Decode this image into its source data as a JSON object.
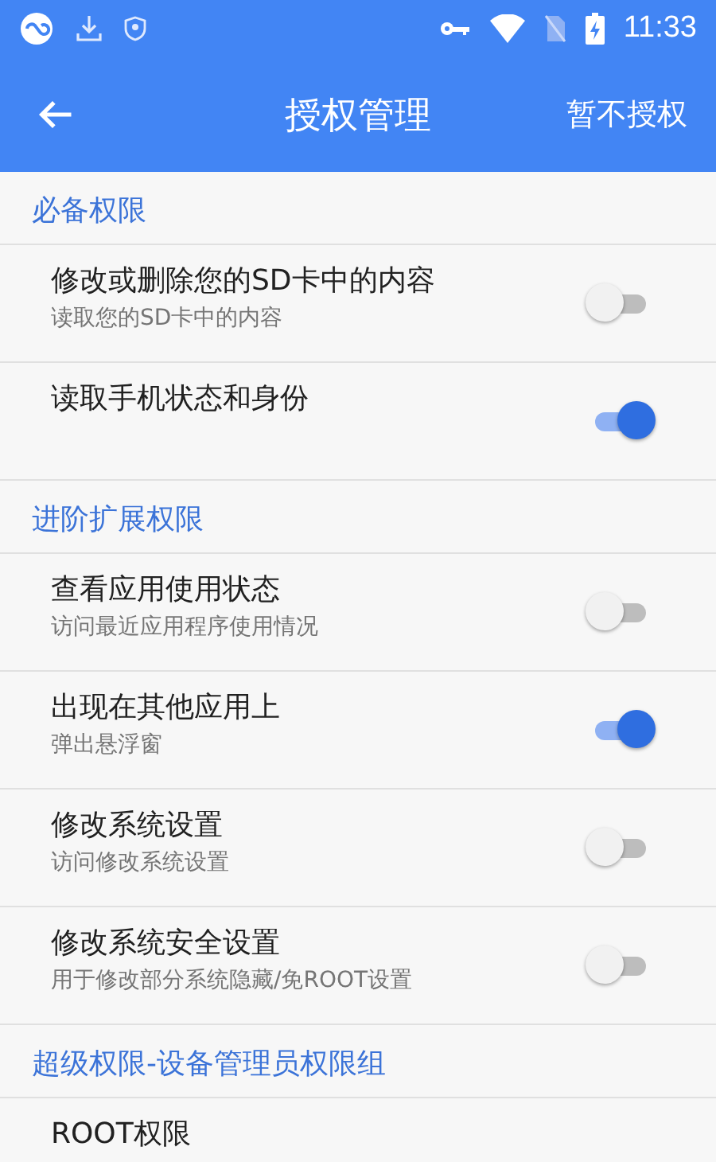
{
  "status_bar": {
    "time": "11:33"
  },
  "app_bar": {
    "title": "授权管理",
    "action": "暂不授权"
  },
  "sections": [
    {
      "title": "必备权限",
      "items": [
        {
          "title": "修改或删除您的SD卡中的内容",
          "subtitle": "读取您的SD卡中的内容",
          "on": false
        },
        {
          "title": "读取手机状态和身份",
          "on": true
        }
      ]
    },
    {
      "title": "进阶扩展权限",
      "items": [
        {
          "title": "查看应用使用状态",
          "subtitle": "访问最近应用程序使用情况",
          "on": false
        },
        {
          "title": "出现在其他应用上",
          "subtitle": "弹出悬浮窗",
          "on": true
        },
        {
          "title": "修改系统设置",
          "subtitle": "访问修改系统设置",
          "on": false
        },
        {
          "title": "修改系统安全设置",
          "subtitle": "用于修改部分系统隐藏/免ROOT设置",
          "on": false
        }
      ]
    },
    {
      "title": "超级权限-设备管理员权限组",
      "items": [
        {
          "title": "ROOT权限"
        }
      ]
    }
  ]
}
